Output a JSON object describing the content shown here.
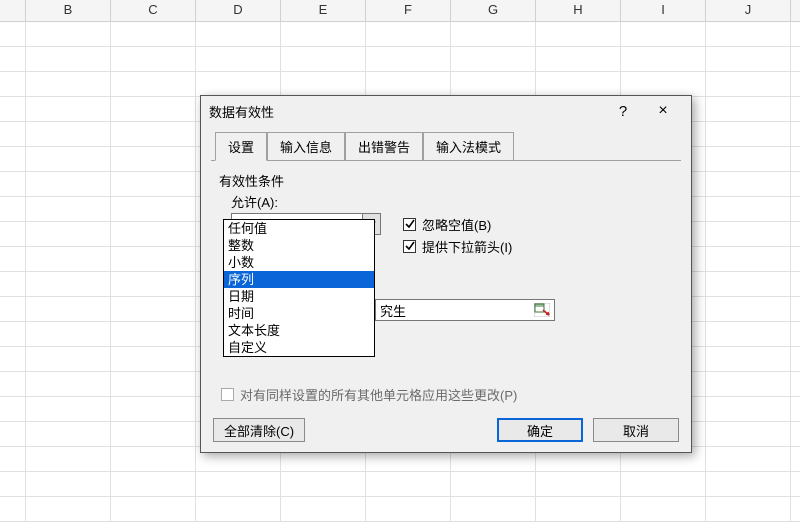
{
  "columns": [
    "B",
    "C",
    "D",
    "E",
    "F",
    "G",
    "H",
    "I",
    "J"
  ],
  "dialog": {
    "title": "数据有效性",
    "help": "?",
    "close": "×",
    "tabs": [
      "设置",
      "输入信息",
      "出错警告",
      "输入法模式"
    ],
    "fieldset_label": "有效性条件",
    "allow_label": "允许(A):",
    "allow_value": "序列",
    "allow_options": [
      "任何值",
      "整数",
      "小数",
      "序列",
      "日期",
      "时间",
      "文本长度",
      "自定义"
    ],
    "allow_selected_index": 3,
    "chk_ignore_blank": "忽略空值(B)",
    "chk_dropdown": "提供下拉箭头(I)",
    "source_value": "究生",
    "apply_all": "对有同样设置的所有其他单元格应用这些更改(P)",
    "clear_all": "全部清除(C)",
    "ok": "确定",
    "cancel": "取消"
  }
}
